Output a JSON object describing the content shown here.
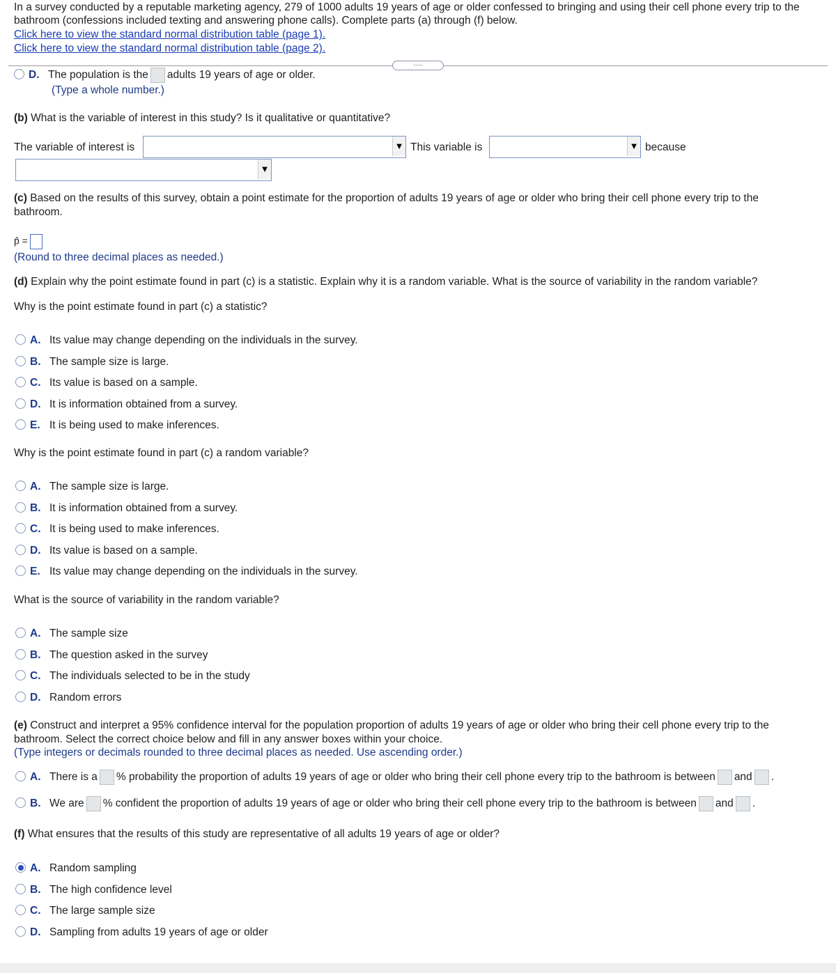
{
  "intro": {
    "line1": "In a survey conducted by a reputable marketing agency, 279 of 1000 adults 19 years of age or older confessed to bringing and using their cell phone every trip to the",
    "line2": "bathroom (confessions included texting and answering phone calls). Complete parts (a) through (f) below.",
    "link1": "Click here to view the standard normal distribution table (page 1).",
    "link2": "Click here to view the standard normal distribution table (page 2).",
    "more": "....."
  },
  "a": {
    "letter": "D.",
    "pre": "The population is the",
    "post": "adults 19 years of age or older.",
    "hint": "(Type a whole number.)"
  },
  "b": {
    "q_bold": "(b)",
    "q": " What is the variable of interest in this study? Is it qualitative or quantitative?",
    "label1": "The variable of interest is",
    "label2": "This variable is",
    "label3": "because"
  },
  "c": {
    "q_bold": "(c)",
    "q1": " Based on the results of this survey, obtain a point estimate for the proportion of adults 19 years of age or older who bring their cell phone every trip to the",
    "q2": "bathroom.",
    "phat": "p̂ =",
    "hint": "(Round to three decimal places as needed.)"
  },
  "d": {
    "q_bold": "(d)",
    "q": " Explain why the point estimate found in part (c) is a statistic. Explain why it is a random variable. What is the source of variability in the random variable?",
    "q1": "Why is the point estimate found in part (c) a statistic?",
    "opts1": [
      {
        "l": "A.",
        "t": "Its value may change depending on the individuals in the survey."
      },
      {
        "l": "B.",
        "t": "The sample size is large."
      },
      {
        "l": "C.",
        "t": "Its value is based on a sample."
      },
      {
        "l": "D.",
        "t": "It is information obtained from a survey."
      },
      {
        "l": "E.",
        "t": "It is being used to make inferences."
      }
    ],
    "q2": "Why is the point estimate found in part (c) a random variable?",
    "opts2": [
      {
        "l": "A.",
        "t": "The sample size is large."
      },
      {
        "l": "B.",
        "t": "It is information obtained from a survey."
      },
      {
        "l": "C.",
        "t": "It is being used to make inferences."
      },
      {
        "l": "D.",
        "t": "Its value is based on a sample."
      },
      {
        "l": "E.",
        "t": "Its value may change depending on the individuals in the survey."
      }
    ],
    "q3": "What is the source of variability in the random variable?",
    "opts3": [
      {
        "l": "A.",
        "t": "The sample size"
      },
      {
        "l": "B.",
        "t": "The question asked in the survey"
      },
      {
        "l": "C.",
        "t": "The individuals selected to be in the study"
      },
      {
        "l": "D.",
        "t": "Random errors"
      }
    ]
  },
  "e": {
    "q_bold": "(e)",
    "q1": " Construct and interpret a 95% confidence interval for the population proportion of adults 19 years of age or older who bring their cell phone every trip to the",
    "q2": "bathroom. Select the correct choice below and fill in any answer boxes within your choice.",
    "hint": "(Type integers or decimals rounded to three decimal places as needed. Use ascending order.)",
    "A": {
      "l": "A.",
      "pre": "There is a",
      "mid": "% probability the proportion of adults 19 years of age or older who bring their cell phone every trip to the bathroom is between",
      "and": "and",
      "end": "."
    },
    "B": {
      "l": "B.",
      "pre": "We are",
      "mid": "% confident the proportion of adults 19 years of age or older who bring their cell phone every trip to the bathroom is between",
      "and": "and",
      "end": "."
    }
  },
  "f": {
    "q_bold": "(f)",
    "q": " What ensures that the results of this study are representative of all adults 19 years of age or older?",
    "selected": "A.",
    "opts": [
      {
        "l": "A.",
        "t": "Random sampling"
      },
      {
        "l": "B.",
        "t": "The high confidence level"
      },
      {
        "l": "C.",
        "t": "The large sample size"
      },
      {
        "l": "D.",
        "t": "Sampling from adults 19 years of age or older"
      }
    ]
  }
}
